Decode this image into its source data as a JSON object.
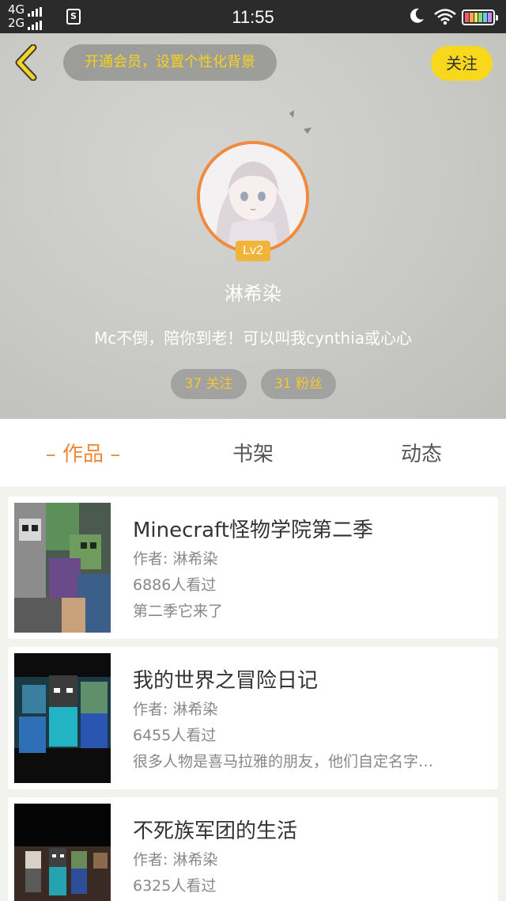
{
  "status_bar": {
    "net_top": "4G",
    "net_bottom": "2G",
    "sim_label": "S",
    "time": "11:55"
  },
  "header": {
    "vip_text": "开通会员，设置个性化背景",
    "follow_label": "关注",
    "level": "Lv2",
    "username": "淋希染",
    "bio": "Mc不倒，陪你到老！可以叫我cynthia或心心",
    "following": "37 关注",
    "fans": "31 粉丝"
  },
  "tabs": [
    {
      "label": "– 作品 –",
      "active": true
    },
    {
      "label": "书架",
      "active": false
    },
    {
      "label": "动态",
      "active": false
    }
  ],
  "works": [
    {
      "title": "Minecraft怪物学院第二季",
      "author": "作者: 淋希染",
      "views": "6886人看过",
      "desc": "第二季它来了"
    },
    {
      "title": "我的世界之冒险日记",
      "author": "作者: 淋希染",
      "views": "6455人看过",
      "desc": "很多人物是喜马拉雅的朋友，他们自定名字…"
    },
    {
      "title": "不死族军团的生活",
      "author": "作者: 淋希染",
      "views": "6325人看过",
      "desc": ""
    }
  ],
  "colors": {
    "accent": "#f0883a",
    "follow_button": "#f7d81c",
    "vip_text": "#f5d320",
    "stat_text": "#f5c63a",
    "level_badge": "#f0b43a"
  },
  "icons": {
    "back": "chevron-left-icon",
    "moon": "moon-icon",
    "wifi": "wifi-icon",
    "battery": "battery-icon"
  }
}
